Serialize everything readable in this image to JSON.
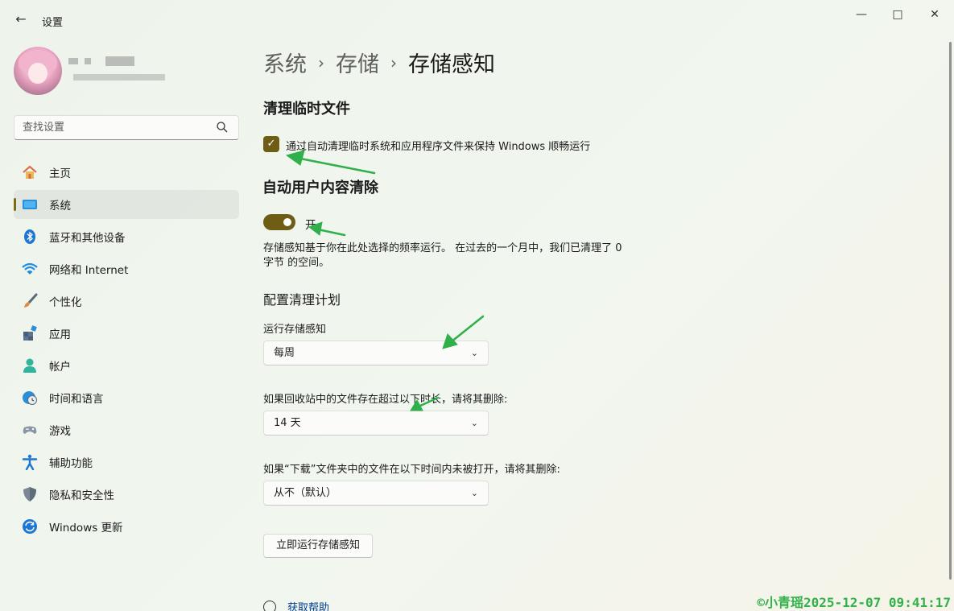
{
  "window": {
    "back_icon": "arrow-left-icon",
    "title": "设置",
    "controls": [
      "minimize-icon",
      "maximize-icon",
      "close-icon"
    ]
  },
  "profile": {
    "avatar": "anime-avatar"
  },
  "search": {
    "placeholder": "查找设置",
    "icon": "search-icon"
  },
  "sidebar": {
    "items": [
      {
        "label": "主页",
        "icon": "home-icon"
      },
      {
        "label": "系统",
        "icon": "system-icon",
        "active": true
      },
      {
        "label": "蓝牙和其他设备",
        "icon": "bluetooth-icon"
      },
      {
        "label": "网络和 Internet",
        "icon": "wifi-icon"
      },
      {
        "label": "个性化",
        "icon": "brush-icon"
      },
      {
        "label": "应用",
        "icon": "apps-icon"
      },
      {
        "label": "帐户",
        "icon": "account-icon"
      },
      {
        "label": "时间和语言",
        "icon": "globe-clock-icon"
      },
      {
        "label": "游戏",
        "icon": "gamepad-icon"
      },
      {
        "label": "辅助功能",
        "icon": "accessibility-icon"
      },
      {
        "label": "隐私和安全性",
        "icon": "shield-icon"
      },
      {
        "label": "Windows 更新",
        "icon": "update-icon"
      }
    ]
  },
  "breadcrumb": {
    "items": [
      "系统",
      "存储",
      "存储感知"
    ],
    "separator": "›"
  },
  "cleanup_temp": {
    "heading": "清理临时文件",
    "checkbox_label": "通过自动清理临时系统和应用程序文件来保持 Windows 顺畅运行",
    "checked": true
  },
  "auto_cleanup": {
    "heading": "自动用户内容清除",
    "toggle_state": "开",
    "toggle_on": true,
    "description": "存储感知基于你在此处选择的频率运行。 在过去的一个月中，我们已清理了 0 字节 的空间。"
  },
  "schedule": {
    "heading": "配置清理计划",
    "run_label": "运行存储感知",
    "run_value": "每周",
    "recycle_label": "如果回收站中的文件存在超过以下时长，请将其删除:",
    "recycle_value": "14 天",
    "downloads_label": "如果“下载”文件夹中的文件在以下时间内未被打开，请将其删除:",
    "downloads_value": "从不（默认）",
    "chevron": "⌄"
  },
  "run_now_button": "立即运行存储感知",
  "help_link": "获取帮助",
  "watermark": "©小青瑶2025-12-07 09:41:17",
  "colors": {
    "accent": "#6f5d15",
    "annotation_arrow": "#2fb04a",
    "link": "#003e92"
  }
}
